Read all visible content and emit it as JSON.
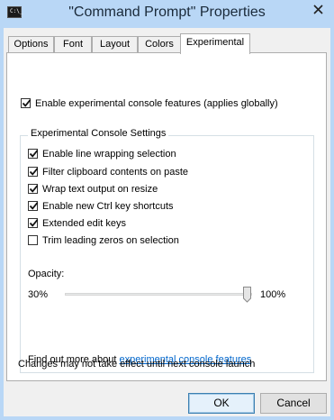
{
  "window": {
    "title": "\"Command Prompt\" Properties",
    "icon_text": "C:\\_"
  },
  "tabs": [
    {
      "label": "Options",
      "active": false
    },
    {
      "label": "Font",
      "active": false
    },
    {
      "label": "Layout",
      "active": false
    },
    {
      "label": "Colors",
      "active": false
    },
    {
      "label": "Experimental",
      "active": true
    }
  ],
  "experimental": {
    "enable_label": "Enable experimental console features (applies globally)",
    "enable_checked": true,
    "group_title": "Experimental Console Settings",
    "options": [
      {
        "label": "Enable line wrapping selection",
        "checked": true
      },
      {
        "label": "Filter clipboard contents on paste",
        "checked": true
      },
      {
        "label": "Wrap text output on resize",
        "checked": true
      },
      {
        "label": "Enable new Ctrl key shortcuts",
        "checked": true
      },
      {
        "label": "Extended edit keys",
        "checked": true
      },
      {
        "label": "Trim leading zeros on selection",
        "checked": false
      }
    ],
    "opacity": {
      "label": "Opacity:",
      "min_label": "30%",
      "max_label": "100%",
      "value_percent": 100
    },
    "find_out_text": "Find out more about ",
    "find_out_link": "experimental console features",
    "note": "Changes may not take effect until next console launch"
  },
  "buttons": {
    "ok": "OK",
    "cancel": "Cancel"
  },
  "colors": {
    "title_bar": "#b9d7f6",
    "link": "#0066cc",
    "close_x": "#222222"
  },
  "icons": {
    "app": "console-app-icon",
    "close": "close-icon",
    "check": "checkmark-icon"
  }
}
